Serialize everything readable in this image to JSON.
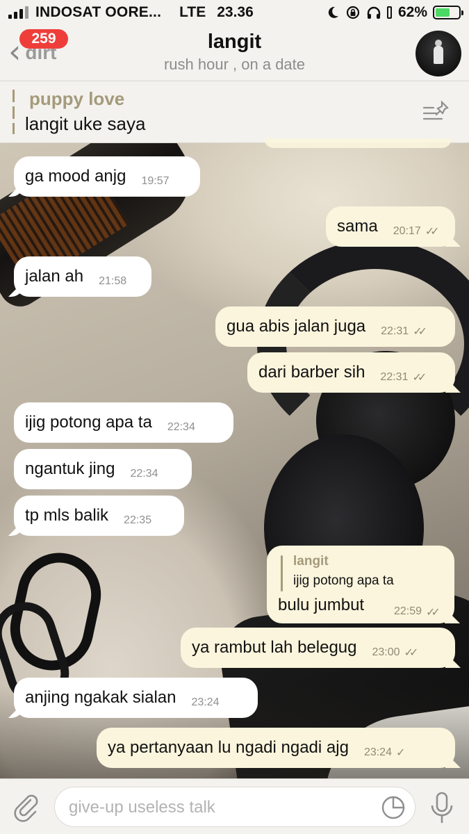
{
  "status_bar": {
    "carrier": "INDOSAT OORE...",
    "network": "LTE",
    "time": "23.36",
    "battery_percent": "62%",
    "battery_level": 0.62,
    "icons": [
      "signal-icon",
      "moon-icon",
      "lock-rotation-icon",
      "headphones-icon",
      "battery-icon"
    ]
  },
  "header": {
    "back_label": "dirt",
    "unread_badge": "259",
    "title": "langit",
    "subtitle": "rush hour , on a date"
  },
  "pinned": {
    "title": "puppy love",
    "text": "langit uke saya"
  },
  "messages": [
    {
      "dir": "in",
      "text": "ga mood anjg",
      "time": "19:57"
    },
    {
      "dir": "out",
      "text": "sama",
      "time": "20:17",
      "status": "read"
    },
    {
      "dir": "in",
      "text": "jalan ah",
      "time": "21:58"
    },
    {
      "dir": "out",
      "text": "gua abis jalan juga",
      "time": "22:31",
      "status": "read"
    },
    {
      "dir": "out",
      "text": "dari barber sih",
      "time": "22:31",
      "status": "read"
    },
    {
      "dir": "in",
      "text": "ijig potong apa ta",
      "time": "22:34"
    },
    {
      "dir": "in",
      "text": "ngantuk jing",
      "time": "22:34"
    },
    {
      "dir": "in",
      "text": "tp mls balik",
      "time": "22:35"
    },
    {
      "dir": "out",
      "text": "bulu jumbut",
      "time": "22:59",
      "status": "read",
      "reply_to": {
        "name": "langit",
        "text": "ijig potong apa ta"
      }
    },
    {
      "dir": "out",
      "text": "ya rambut lah belegug",
      "time": "23:00",
      "status": "read"
    },
    {
      "dir": "in",
      "text": "anjing ngakak sialan",
      "time": "23:24"
    },
    {
      "dir": "out",
      "text": "ya pertanyaan lu ngadi ngadi ajg",
      "time": "23:24",
      "status": "sent"
    }
  ],
  "input": {
    "placeholder": "give-up useless talk",
    "value": ""
  },
  "colors": {
    "incoming_bubble": "#ffffff",
    "outgoing_bubble": "#fbf5dd",
    "badge": "#ef3e3a",
    "battery": "#4cd964",
    "accent_muted": "#a59a7c"
  }
}
